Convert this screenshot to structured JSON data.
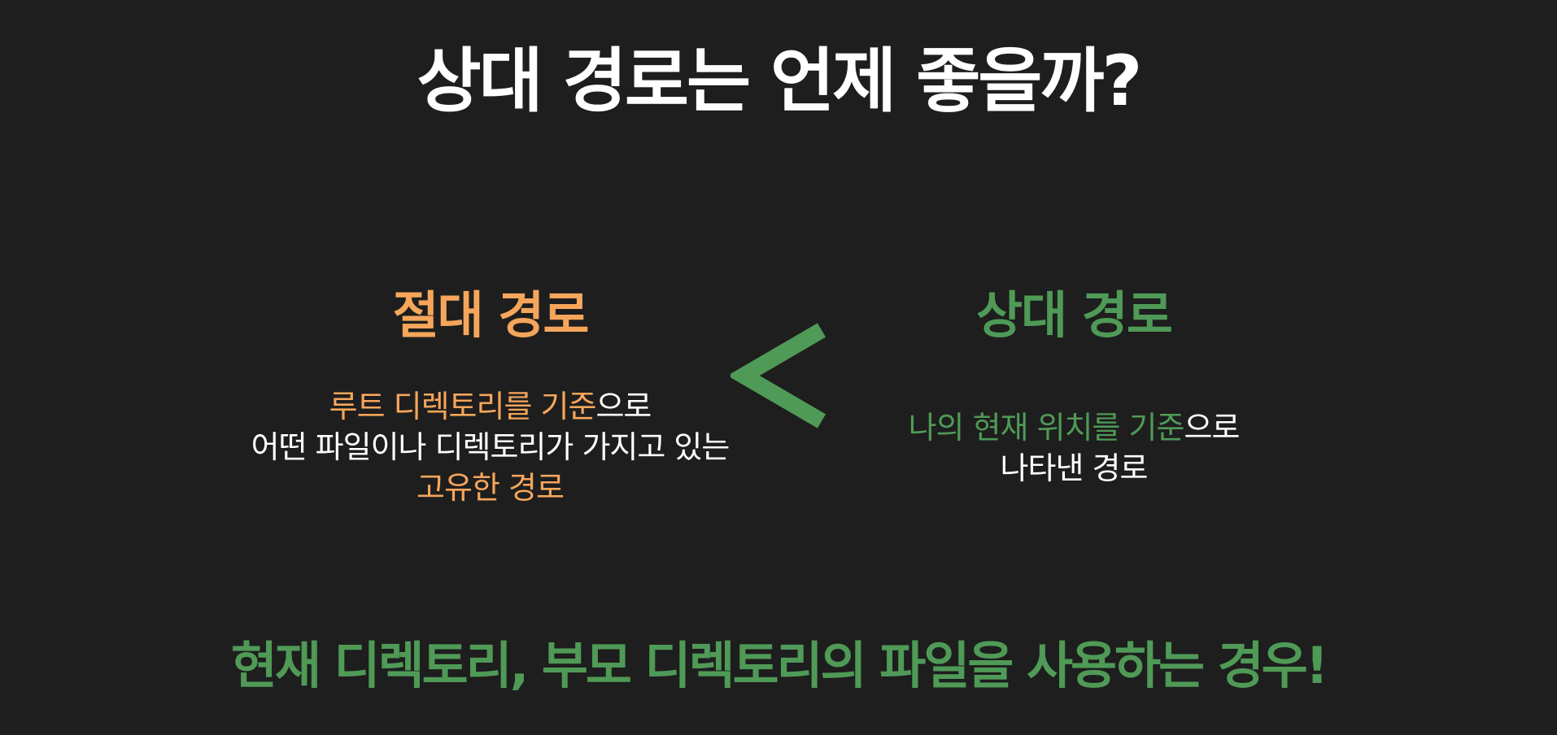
{
  "title": "상대 경로는 언제 좋을까?",
  "absolute": {
    "heading": "절대 경로",
    "desc": {
      "line1_highlight": "루트 디렉토리를 기준",
      "line1_rest": "으로",
      "line2": "어떤 파일이나 디렉토리가 가지고 있는",
      "line3_highlight": "고유한 경로"
    }
  },
  "relative": {
    "heading": "상대 경로",
    "desc": {
      "line1_highlight": "나의 현재 위치를 기준",
      "line1_rest": "으로",
      "line2": "나타낸 경로"
    }
  },
  "comparison_symbol": "less-than-icon",
  "footer": "현재 디렉토리, 부모 디렉토리의 파일을 사용하는 경우!",
  "colors": {
    "background": "#1e1e1e",
    "absolute_accent": "#f5a65b",
    "relative_accent": "#4f9a56",
    "text": "#ffffff"
  }
}
